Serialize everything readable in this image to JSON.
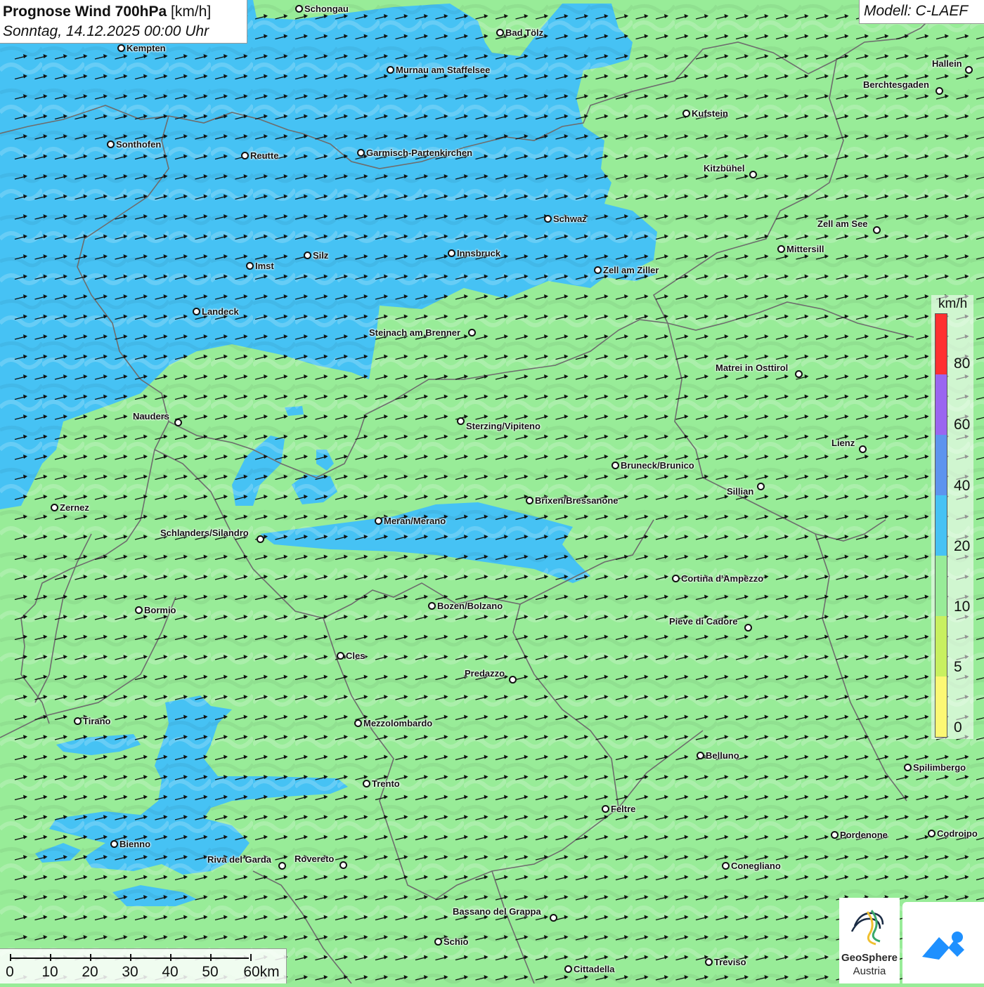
{
  "title": {
    "bold": "Prognose Wind 700hPa",
    "unit": " [km/h]",
    "date": "Sonntag, 14.12.2025 00:00 Uhr"
  },
  "model": "Modell: C-LAEF",
  "colors": {
    "land_green": "#98ec98",
    "wind_blue": "#46c2f4",
    "arrow": "#111111",
    "border": "#6d6d6d"
  },
  "wind_direction": "east-northeast",
  "cities": [
    {
      "name": "Schongau"
    },
    {
      "name": "Bad Tölz"
    },
    {
      "name": "Kempten"
    },
    {
      "name": "Murnau am Staffelsee"
    },
    {
      "name": "Hallein"
    },
    {
      "name": "Berchtesgaden"
    },
    {
      "name": "Kufstein"
    },
    {
      "name": "Sonthofen"
    },
    {
      "name": "Reutte"
    },
    {
      "name": "Garmisch-Partenkirchen"
    },
    {
      "name": "Kitzbühel"
    },
    {
      "name": "Schwaz"
    },
    {
      "name": "Zell am See"
    },
    {
      "name": "Mittersill"
    },
    {
      "name": "Silz"
    },
    {
      "name": "Innsbruck"
    },
    {
      "name": "Imst"
    },
    {
      "name": "Zell am Ziller"
    },
    {
      "name": "Landeck"
    },
    {
      "name": "Steinach am Brenner"
    },
    {
      "name": "Matrei in Osttirol"
    },
    {
      "name": "Nauders"
    },
    {
      "name": "Sterzing/Vipiteno"
    },
    {
      "name": "Lienz"
    },
    {
      "name": "Bruneck/Brunico"
    },
    {
      "name": "Sillian"
    },
    {
      "name": "Brixen/Bressanone"
    },
    {
      "name": "Zernez"
    },
    {
      "name": "Meran/Merano"
    },
    {
      "name": "Schlanders/Silandro"
    },
    {
      "name": "Cortina d'Ampezzo"
    },
    {
      "name": "Bozen/Bolzano"
    },
    {
      "name": "Bormio"
    },
    {
      "name": "Pieve di Cadore"
    },
    {
      "name": "Cles"
    },
    {
      "name": "Predazzo"
    },
    {
      "name": "Tirano"
    },
    {
      "name": "Mezzolombardo"
    },
    {
      "name": "Belluno"
    },
    {
      "name": "Spilimbergo"
    },
    {
      "name": "Trento"
    },
    {
      "name": "Feltre"
    },
    {
      "name": "Pordenone"
    },
    {
      "name": "Codroipo"
    },
    {
      "name": "Bienno"
    },
    {
      "name": "Riva del Garda"
    },
    {
      "name": "Rovereto"
    },
    {
      "name": "Conegliano"
    },
    {
      "name": "Bassano del Grappa"
    },
    {
      "name": "Schio"
    },
    {
      "name": "Treviso"
    },
    {
      "name": "Cittadella"
    }
  ],
  "legend": {
    "unit": "km/h",
    "ticks": [
      "80",
      "60",
      "40",
      "20",
      "10",
      "5",
      "0"
    ],
    "bands": [
      {
        "color": "#ff3030"
      },
      {
        "color": "#9a66f0"
      },
      {
        "color": "#5d94ee"
      },
      {
        "color": "#46c2f4"
      },
      {
        "color": "#98ec98"
      },
      {
        "color": "#c8f060"
      },
      {
        "color": "#fcf874"
      }
    ]
  },
  "scale": {
    "labels": [
      "0",
      "10",
      "20",
      "30",
      "40",
      "50",
      "60km"
    ]
  },
  "logos": {
    "geosphere_line1": "GeoSphere",
    "geosphere_line2": "Austria"
  }
}
